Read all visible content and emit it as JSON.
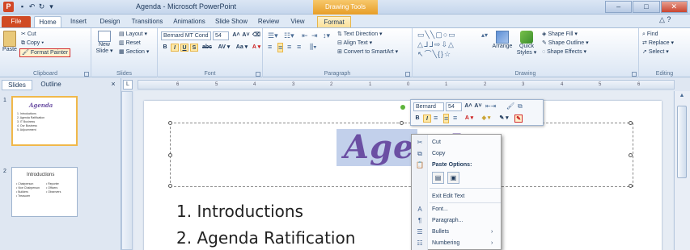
{
  "window": {
    "title": "Agenda - Microsoft PowerPoint",
    "contextual_tab_group": "Drawing Tools",
    "minimize": "–",
    "maximize": "□",
    "close": "✕",
    "help_icons": "△ ?"
  },
  "qat": {
    "save": "▪",
    "undo": "↶",
    "redo": "↻",
    "dropdown": "▾"
  },
  "tabs": [
    "File",
    "Home",
    "Insert",
    "Design",
    "Transitions",
    "Animations",
    "Slide Show",
    "Review",
    "View",
    "Format"
  ],
  "ribbon": {
    "clipboard": {
      "paste": "Paste",
      "cut": "Cut",
      "copy": "Copy ▾",
      "format_painter": "Format Painter",
      "label": "Clipboard"
    },
    "slides": {
      "new_slide": "New Slide ▾",
      "layout": "Layout ▾",
      "reset": "Reset",
      "section": "Section ▾",
      "label": "Slides"
    },
    "font": {
      "font_name": "Bernard MT Cond",
      "font_size": "54",
      "grow": "A˄",
      "shrink": "A˅",
      "clear": "⌫",
      "bold": "B",
      "italic": "I",
      "underline": "U",
      "shadow": "S",
      "strike": "abc",
      "spacing": "AV ▾",
      "case": "Aa ▾",
      "color": "A ▾",
      "label": "Font"
    },
    "paragraph": {
      "label": "Paragraph",
      "text_direction": "Text Direction ▾",
      "align_text": "Align Text ▾",
      "smartart": "Convert to SmartArt ▾"
    },
    "drawing": {
      "label": "Drawing",
      "arrange": "Arrange",
      "quick_styles": "Quick Styles ▾",
      "shape_fill": "Shape Fill ▾",
      "shape_outline": "Shape Outline ▾",
      "shape_effects": "Shape Effects ▾"
    },
    "editing": {
      "label": "Editing",
      "find": "Find",
      "replace": "Replace ▾",
      "select": "Select ▾"
    }
  },
  "panel": {
    "tab_slides": "Slides",
    "tab_outline": "Outline",
    "close": "×",
    "slide1": {
      "num": "1",
      "title": "Agenda",
      "bullets": [
        "1. Introductions",
        "2. Agenda Ratification",
        "3. IT Business",
        "4. Our Business",
        "5. Adjournment"
      ]
    },
    "slide2": {
      "num": "2",
      "title": "Introductions",
      "bullets": [
        "• Chairperson",
        "• Vice Chairperson",
        "• Builders",
        "• Treasurer",
        "• Reporter",
        "• Officers",
        "• Observers"
      ]
    }
  },
  "ruler": {
    "corner": "L",
    "marks": [
      "6",
      "5",
      "4",
      "3",
      "2",
      "1",
      "0",
      "1",
      "2",
      "3",
      "4",
      "5",
      "6"
    ]
  },
  "slide": {
    "title": "Agenda",
    "items": [
      "1.  Introductions",
      "2.  Agenda Ratification"
    ]
  },
  "mini_toolbar": {
    "font": "Bernard",
    "size": "54",
    "grow": "A˄",
    "shrink": "A˅",
    "bold": "B",
    "italic": "I",
    "color": "A ▾",
    "fill": "◈ ▾",
    "outline": "✎ ▾"
  },
  "context_menu": {
    "cut": "Cut",
    "copy": "Copy",
    "paste_options": "Paste Options:",
    "exit_edit": "Exit Edit Text",
    "font": "Font...",
    "paragraph": "Paragraph...",
    "bullets": "Bullets",
    "numbering": "Numbering",
    "submenu_arrow": "›"
  }
}
